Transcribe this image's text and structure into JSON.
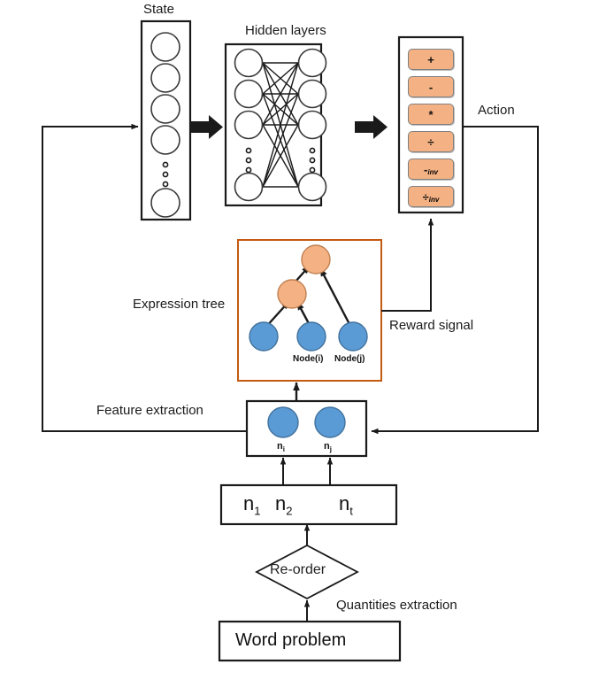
{
  "diagram": {
    "title_state": "State",
    "title_hidden": "Hidden layers",
    "label_action": "Action",
    "label_expression_tree": "Expression tree",
    "label_reward_signal": "Reward signal",
    "label_feature_extraction": "Feature extraction",
    "label_quantities_extraction": "Quantities extraction",
    "label_reorder": "Re-order",
    "label_word_problem": "Word problem"
  },
  "colors": {
    "orange_fill": "#F4B183",
    "orange_stroke": "#7F7F7F",
    "blue_fill": "#5B9BD5",
    "blue_stroke": "#41719C",
    "tree_border": "#C55A11",
    "line": "#1A1A1A"
  },
  "state_box": {
    "circles": 4,
    "ellipsis_dots": 3,
    "tail_circles": 1
  },
  "hidden_layers": {
    "left_nodes": 4,
    "right_nodes": 4,
    "ellipsis_dots": 3,
    "fully_connected": true
  },
  "action_box": {
    "operators": [
      {
        "symbol": "+",
        "sub": ""
      },
      {
        "symbol": "-",
        "sub": ""
      },
      {
        "symbol": "*",
        "sub": ""
      },
      {
        "symbol": "÷",
        "sub": ""
      },
      {
        "symbol": "-",
        "sub": "inv"
      },
      {
        "symbol": "÷",
        "sub": "inv"
      }
    ]
  },
  "expression_tree": {
    "internal_nodes": 2,
    "leaf_nodes": 3,
    "leaf_labels": [
      "",
      "Node(i)",
      "Node(j)"
    ]
  },
  "feature_box": {
    "nodes": [
      {
        "label_base": "n",
        "label_sub": "i"
      },
      {
        "label_base": "n",
        "label_sub": "j"
      }
    ]
  },
  "quantities_box": {
    "items": [
      {
        "base": "n",
        "sub": "1"
      },
      {
        "base": "n",
        "sub": "2"
      },
      {
        "base": "n",
        "sub": "t"
      }
    ]
  }
}
